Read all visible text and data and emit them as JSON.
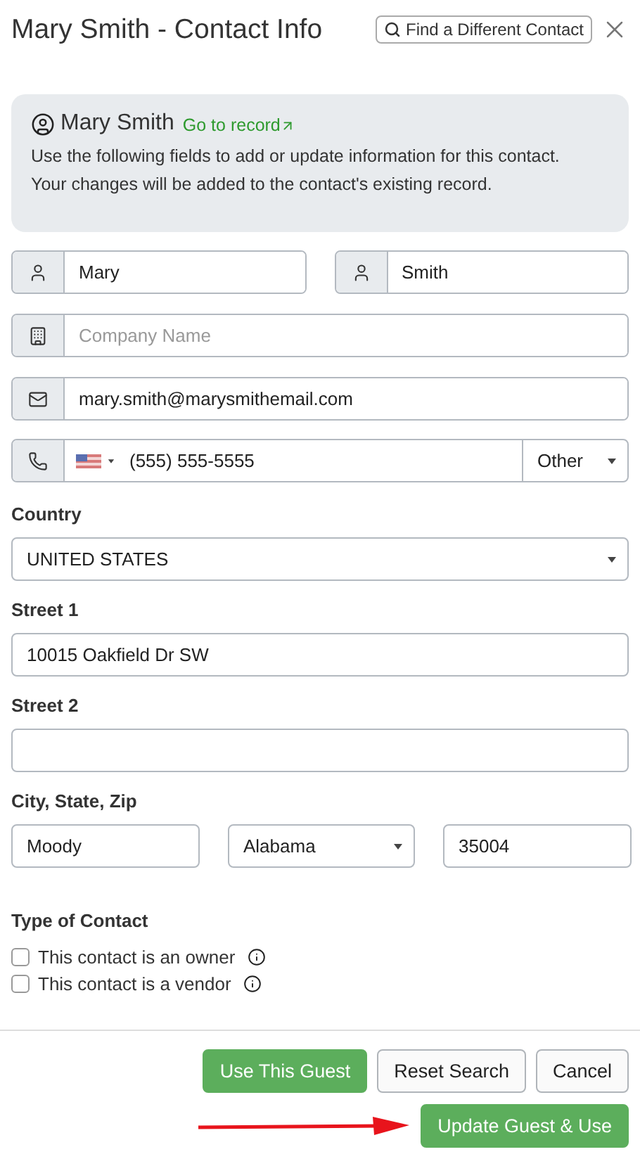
{
  "header": {
    "title": "Mary Smith - Contact Info",
    "find_button": "Find a Different Contact"
  },
  "info": {
    "name": "Mary Smith",
    "link": "Go to record",
    "sentences": [
      "Use the following fields to add or update information for this contact.",
      "Your changes will be added to the contact's existing record."
    ]
  },
  "name_fields": [
    {
      "kind": "person",
      "value": "Mary"
    },
    {
      "kind": "person",
      "value": "Smith"
    }
  ],
  "company": {
    "kind": "building",
    "placeholder": "Company Name"
  },
  "email": {
    "kind": "mail",
    "value": "mary.smith@marysmithemail.com"
  },
  "phone": {
    "kind": "phone",
    "number": "(555) 555-5555",
    "type": "Other"
  },
  "country": {
    "label": "Country",
    "value": "UNITED STATES"
  },
  "street1": {
    "label": "Street 1",
    "value": "10015 Oakfield Dr SW"
  },
  "street2": {
    "label": "Street 2"
  },
  "city_state_zip": {
    "label": "City, State, Zip",
    "city": "Moody",
    "state": "Alabama",
    "zip": "35004"
  },
  "contact_type": {
    "label": "Type of Contact",
    "options": [
      {
        "label": "This contact is an owner",
        "checked": false
      },
      {
        "label": "This contact is a vendor",
        "checked": false
      }
    ]
  },
  "buttons": [
    {
      "label": "Use This Guest",
      "kind": "primary"
    },
    {
      "label": "Reset Search",
      "kind": "secondary"
    },
    {
      "label": "Cancel",
      "kind": "secondary"
    }
  ],
  "final_button": {
    "label": "Update Guest & Use",
    "kind": "primary"
  }
}
